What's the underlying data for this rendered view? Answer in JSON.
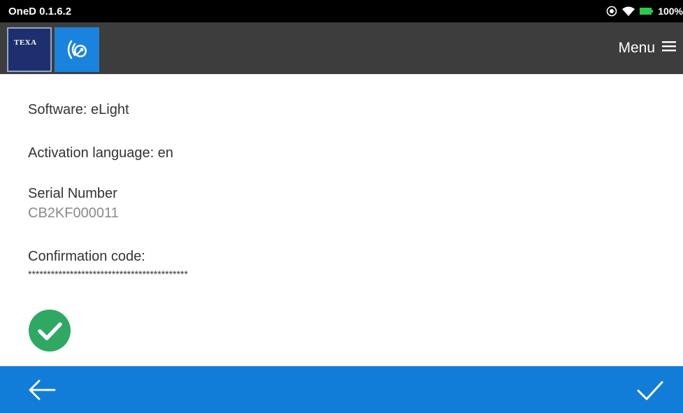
{
  "status_bar": {
    "app_version": "OneD 0.1.6.2",
    "battery_text": "100%"
  },
  "header": {
    "brand_logo_text": "TEXA",
    "menu_label": "Menu"
  },
  "details": {
    "software": "Software: eLight",
    "activation_language": "Activation language: en",
    "serial_label": "Serial Number",
    "serial_value": "CB2KF000011",
    "confirmation_label": "Confirmation code:",
    "confirmation_value": "******************************************"
  },
  "icons": {
    "status": [
      "location-icon",
      "wifi-icon",
      "battery-icon"
    ],
    "header": [
      "texa-logo",
      "app-logo-icon",
      "hamburger-menu-icon"
    ],
    "content": [
      "success-check-icon"
    ],
    "footer": [
      "back-arrow-icon",
      "confirm-check-icon"
    ]
  },
  "colors": {
    "header_bg": "#3d3d3d",
    "footer_bg": "#127dd8",
    "success_green": "#2ea863",
    "texa_blue": "#1d2f6e",
    "app_logo_blue": "#1a83dd"
  }
}
